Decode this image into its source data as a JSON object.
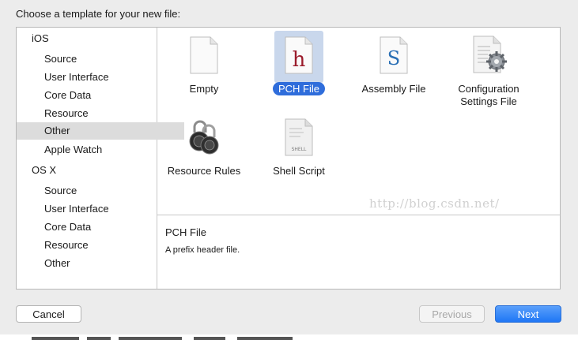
{
  "dialog": {
    "prompt": "Choose a template for your new file:"
  },
  "sidebar": {
    "items": [
      {
        "label": "iOS",
        "kind": "platform"
      },
      {
        "label": "Source",
        "kind": "category"
      },
      {
        "label": "User Interface",
        "kind": "category"
      },
      {
        "label": "Core Data",
        "kind": "category"
      },
      {
        "label": "Resource",
        "kind": "category"
      },
      {
        "label": "Other",
        "kind": "category",
        "selected": true
      },
      {
        "label": "Apple Watch",
        "kind": "category"
      },
      {
        "label": "OS X",
        "kind": "platform"
      },
      {
        "label": "Source",
        "kind": "category"
      },
      {
        "label": "User Interface",
        "kind": "category"
      },
      {
        "label": "Core Data",
        "kind": "category"
      },
      {
        "label": "Resource",
        "kind": "category"
      },
      {
        "label": "Other",
        "kind": "category"
      }
    ]
  },
  "templates": [
    {
      "label": "Empty",
      "icon": "empty-file-icon"
    },
    {
      "label": "PCH File",
      "icon": "pch-file-icon",
      "glyph": "h",
      "selected": true
    },
    {
      "label": "Assembly File",
      "icon": "assembly-file-icon",
      "glyph": "S"
    },
    {
      "label": "Configuration Settings File",
      "label_lines": [
        "Configuration",
        "Settings File"
      ],
      "icon": "configuration-settings-icon"
    },
    {
      "label": "Resource Rules",
      "icon": "padlock-icon"
    },
    {
      "label": "Shell Script",
      "icon": "shell-script-icon",
      "glyph": "SHELL"
    }
  ],
  "description": {
    "title": "PCH File",
    "text": "A prefix header file."
  },
  "watermark": "http://blog.csdn.net/",
  "buttons": {
    "cancel": "Cancel",
    "previous": "Previous",
    "next": "Next"
  },
  "colors": {
    "selection": "#2f6ddb",
    "accent_next": "#1f76f5",
    "pch_glyph": "#9b1c2c",
    "asm_glyph": "#2a6fb5"
  }
}
